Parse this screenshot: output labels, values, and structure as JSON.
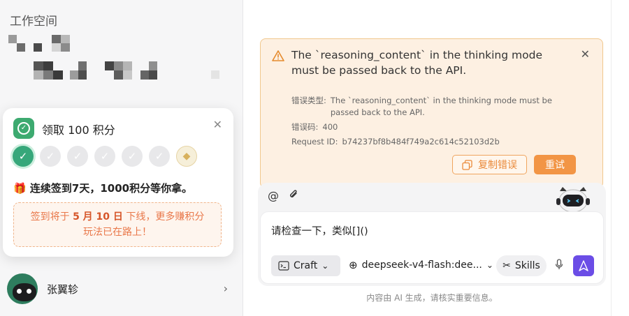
{
  "sidebar": {
    "workspace_title": "工作空间",
    "user": {
      "name": "张翼轸"
    }
  },
  "popover": {
    "title": "领取 100 积分",
    "message": "🎁 连续签到7天，1000积分等你拿。",
    "notice_prefix": "签到将于 ",
    "notice_date": "5 月 10 日",
    "notice_suffix": " 下线，更多赚积分玩法已在路上！",
    "days": [
      {
        "state": "done"
      },
      {
        "state": "pending"
      },
      {
        "state": "pending"
      },
      {
        "state": "pending"
      },
      {
        "state": "pending"
      },
      {
        "state": "pending"
      },
      {
        "state": "reward"
      }
    ],
    "colors": {
      "done": "#36a77a",
      "notice_text": "#e9784a"
    }
  },
  "error": {
    "headline": "The `reasoning_content` in the thinking mode must be passed back to the API.",
    "type_label": "错误类型:",
    "type_value": "The `reasoning_content` in the thinking mode must be passed back to the API.",
    "code_label": "错误码:",
    "code_value": "400",
    "request_label": "Request ID:",
    "request_value": "b74237bf8b484f749a2c614c52103d2b",
    "copy_label": "复制错误",
    "retry_label": "重试",
    "colors": {
      "background": "#fdf0e2",
      "accent": "#f29545"
    }
  },
  "composer": {
    "input_text": "请检查一下，类似[]()",
    "craft_label": "Craft",
    "model_label": "deepseek-v4-flash:dee...",
    "skills_label": "Skills",
    "send_color": "#6b4de6"
  },
  "footer": {
    "disclaimer": "内容由 AI 生成，请核实重要信息。"
  }
}
